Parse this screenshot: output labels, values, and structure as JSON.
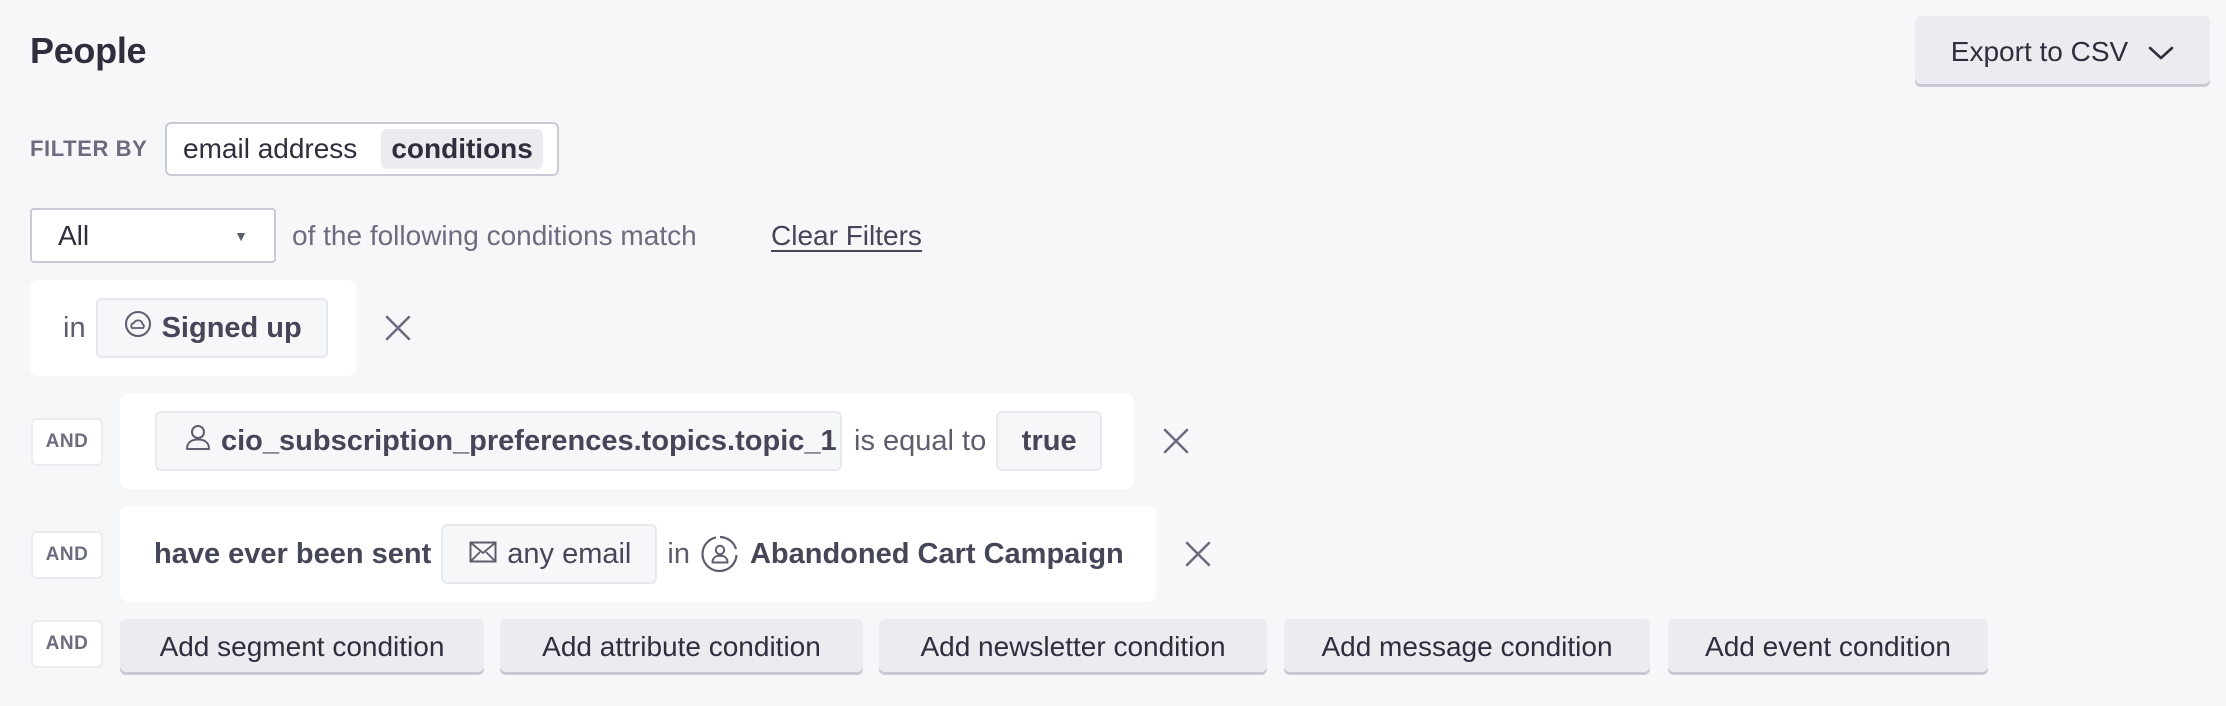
{
  "header": {
    "title": "People",
    "export_label": "Export to CSV",
    "export_icon": "chevron-down-icon"
  },
  "filter": {
    "label": "FILTER BY",
    "options": [
      "email address",
      "conditions"
    ],
    "active_option": "conditions"
  },
  "match": {
    "selected": "All",
    "select_icon": "caret-down-icon",
    "suffix_text": "of the following conditions match",
    "clear_label": "Clear Filters"
  },
  "conditions": [
    {
      "type": "segment",
      "prefix": "in",
      "value": "Signed up",
      "icon": "segment-icon"
    },
    {
      "type": "attribute",
      "connector": "AND",
      "attribute": "cio_subscription_preferences.topics.topic_1",
      "attribute_icon": "person-icon",
      "operator": "is equal to",
      "value": "true"
    },
    {
      "type": "message",
      "connector": "AND",
      "lead": "have ever been sent",
      "message": "any email",
      "message_icon": "envelope-icon",
      "in_text": "in",
      "campaign": "Abandoned Cart Campaign",
      "campaign_icon": "campaign-icon"
    }
  ],
  "add": {
    "connector": "AND",
    "buttons": [
      "Add segment condition",
      "Add attribute condition",
      "Add newsletter condition",
      "Add message condition",
      "Add event condition"
    ]
  },
  "colors": {
    "background": "#f6f7f9",
    "text_primary": "#2e2e3c",
    "text_muted": "#6b6d7f",
    "button_bg": "#ebecf0"
  }
}
